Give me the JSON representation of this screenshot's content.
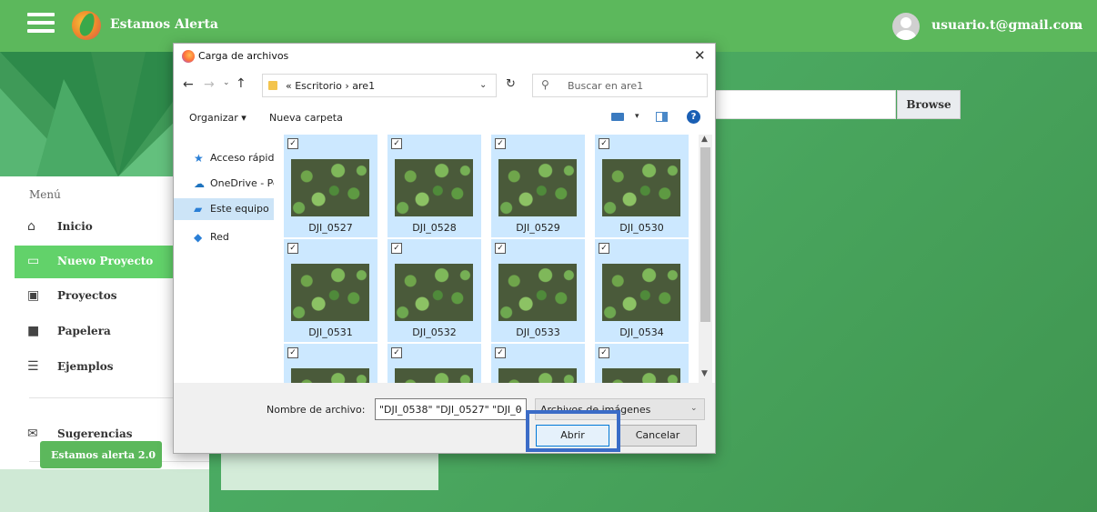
{
  "app": {
    "title": "Estamos Alerta"
  },
  "user": {
    "email": "usuario.t@gmail.com"
  },
  "sidebar": {
    "menu_title": "Menú",
    "items": [
      {
        "label": "Inicio",
        "icon": "home-icon"
      },
      {
        "label": "Nuevo Proyecto",
        "icon": "new-project-icon",
        "active": true
      },
      {
        "label": "Proyectos",
        "icon": "grid-icon"
      },
      {
        "label": "Papelera",
        "icon": "trash-grid-icon"
      },
      {
        "label": "Ejemplos",
        "icon": "list-icon"
      },
      {
        "label": "Sugerencias",
        "icon": "mail-icon"
      }
    ],
    "footer_button": "Estamos alerta 2.0"
  },
  "main": {
    "browse_label": "Browse"
  },
  "dialog": {
    "title": "Carga de archivos",
    "path": "« Escritorio › are1",
    "search_placeholder": "Buscar en are1",
    "toolbar": {
      "organize": "Organizar ▾",
      "new_folder": "Nueva carpeta"
    },
    "nav": [
      {
        "label": "Acceso rápido",
        "icon": "star-icon"
      },
      {
        "label": "OneDrive - Pe",
        "icon": "cloud-icon"
      },
      {
        "label": "Este equipo",
        "icon": "computer-icon",
        "selected": true
      },
      {
        "label": "Red",
        "icon": "network-icon"
      }
    ],
    "files": [
      "DJI_0527",
      "DJI_0528",
      "DJI_0529",
      "DJI_0530",
      "DJI_0531",
      "DJI_0532",
      "DJI_0533",
      "DJI_0534",
      "",
      "",
      "",
      ""
    ],
    "filename_label": "Nombre de archivo:",
    "filename_value": "\"DJI_0538\" \"DJI_0527\" \"DJI_0",
    "filetype": "Archivos de imágenes",
    "open_button": "Abrir",
    "cancel_button": "Cancelar"
  },
  "colors": {
    "accent": "#5cb85c",
    "active": "#62d26a",
    "highlight": "#3b6cc7"
  }
}
